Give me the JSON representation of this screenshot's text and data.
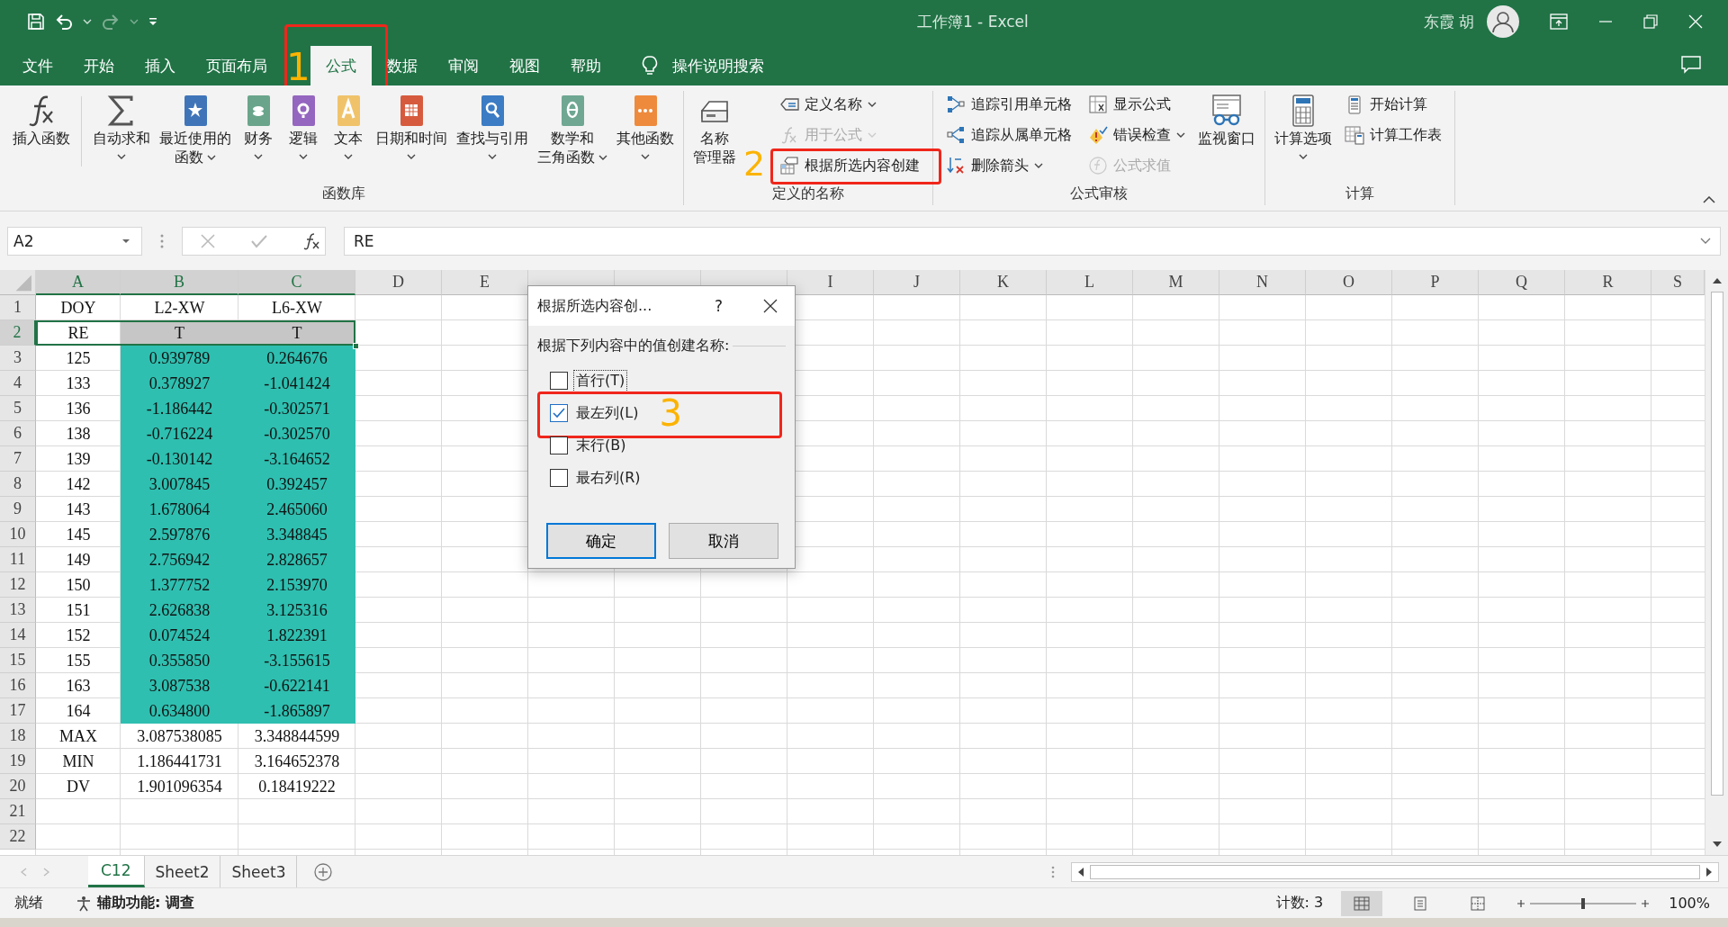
{
  "title_bar": {
    "title": "工作簿1  -  Excel",
    "user": "东霞 胡"
  },
  "menu_tabs": [
    {
      "label": "文件",
      "selected": false
    },
    {
      "label": "开始",
      "selected": false
    },
    {
      "label": "插入",
      "selected": false
    },
    {
      "label": "页面布局",
      "selected": false
    },
    {
      "label": "公式",
      "selected": true,
      "annotation": "1"
    },
    {
      "label": "数据",
      "selected": false
    },
    {
      "label": "审阅",
      "selected": false
    },
    {
      "label": "视图",
      "selected": false
    },
    {
      "label": "帮助",
      "selected": false
    }
  ],
  "tell_me": "操作说明搜索",
  "ribbon_groups": [
    {
      "label": "函数库",
      "items": [
        {
          "kind": "large",
          "label": "插入函数",
          "dropdown": false,
          "divider_after": true
        },
        {
          "kind": "large",
          "label": "自动求和",
          "dropdown": true
        },
        {
          "kind": "large",
          "label_lines": [
            "最近使用的",
            "函数"
          ],
          "dropdown": true,
          "color": "#3f75b8"
        },
        {
          "kind": "large",
          "label": "财务",
          "dropdown": true,
          "color": "#6aa58b"
        },
        {
          "kind": "large",
          "label": "逻辑",
          "dropdown": true,
          "color": "#9466bf"
        },
        {
          "kind": "large",
          "label": "文本",
          "dropdown": true,
          "color": "#f0c36b"
        },
        {
          "kind": "large",
          "label": "日期和时间",
          "dropdown": true,
          "color": "#d65b3e"
        },
        {
          "kind": "large",
          "label": "查找与引用",
          "dropdown": true,
          "color": "#3b7cc4"
        },
        {
          "kind": "large",
          "label_lines": [
            "数学和",
            "三角函数"
          ],
          "dropdown": true,
          "color": "#6fa792"
        },
        {
          "kind": "large",
          "label": "其他函数",
          "dropdown": true,
          "color": "#ee8a3c"
        }
      ]
    },
    {
      "label": "定义的名称",
      "items": [
        {
          "kind": "large",
          "label_lines": [
            "名称",
            "管理器"
          ],
          "dropdown": false
        },
        {
          "kind": "small",
          "label": "定义名称",
          "dropdown": true,
          "disabled": false
        },
        {
          "kind": "small",
          "label": "用于公式",
          "dropdown": true,
          "disabled": true
        },
        {
          "kind": "small",
          "label": "根据所选内容创建",
          "dropdown": false,
          "disabled": false,
          "annotation": "2"
        }
      ]
    },
    {
      "label": "公式审核",
      "items": [
        {
          "kind": "small",
          "label": "追踪引用单元格",
          "dropdown": false,
          "disabled": false
        },
        {
          "kind": "small",
          "label": "追踪从属单元格",
          "dropdown": false,
          "disabled": false
        },
        {
          "kind": "small",
          "label": "删除箭头",
          "dropdown": true,
          "disabled": false
        },
        {
          "kind": "small",
          "label": "显示公式",
          "dropdown": false,
          "disabled": false
        },
        {
          "kind": "small",
          "label": "错误检查",
          "dropdown": true,
          "disabled": false
        },
        {
          "kind": "small",
          "label": "公式求值",
          "dropdown": false,
          "disabled": true
        },
        {
          "kind": "large",
          "label": "监视窗口",
          "dropdown": false
        }
      ]
    },
    {
      "label": "计算",
      "items": [
        {
          "kind": "large",
          "label": "计算选项",
          "dropdown": true
        },
        {
          "kind": "small",
          "label": "开始计算",
          "dropdown": false,
          "disabled": false
        },
        {
          "kind": "small",
          "label": "计算工作表",
          "dropdown": false,
          "disabled": false
        }
      ]
    }
  ],
  "formula_bar": {
    "name_box": "A2",
    "value": "RE"
  },
  "columns": [
    {
      "label": "A",
      "selected": true
    },
    {
      "label": "B",
      "selected": true
    },
    {
      "label": "C",
      "selected": true
    },
    {
      "label": "D",
      "selected": false
    },
    {
      "label": "E",
      "selected": false
    },
    {
      "selected": false
    },
    {
      "selected": false
    },
    {
      "selected": false
    },
    {
      "label": "I",
      "selected": false
    },
    {
      "label": "J",
      "selected": false
    },
    {
      "label": "K",
      "selected": false
    },
    {
      "label": "L",
      "selected": false
    },
    {
      "label": "M",
      "selected": false
    },
    {
      "label": "N",
      "selected": false
    },
    {
      "label": "O",
      "selected": false
    },
    {
      "label": "P",
      "selected": false
    },
    {
      "label": "Q",
      "selected": false
    },
    {
      "label": "R",
      "selected": false
    },
    {
      "label": "S",
      "selected": false
    }
  ],
  "rows": [
    {
      "number": "1",
      "selected": false,
      "shaded": false,
      "cells": [
        "DOY",
        "L2-XW",
        "L6-XW"
      ]
    },
    {
      "number": "2",
      "selected": true,
      "shaded": false,
      "cells": [
        "RE",
        "T",
        "T"
      ]
    },
    {
      "number": "3",
      "selected": false,
      "shaded": true,
      "cells": [
        "125",
        "0.939789",
        "0.264676"
      ]
    },
    {
      "number": "4",
      "selected": false,
      "shaded": true,
      "cells": [
        "133",
        "0.378927",
        "-1.041424"
      ]
    },
    {
      "number": "5",
      "selected": false,
      "shaded": true,
      "cells": [
        "136",
        "-1.186442",
        "-0.302571"
      ]
    },
    {
      "number": "6",
      "selected": false,
      "shaded": true,
      "cells": [
        "138",
        "-0.716224",
        "-0.302570"
      ]
    },
    {
      "number": "7",
      "selected": false,
      "shaded": true,
      "cells": [
        "139",
        "-0.130142",
        "-3.164652"
      ]
    },
    {
      "number": "8",
      "selected": false,
      "shaded": true,
      "cells": [
        "142",
        "3.007845",
        "0.392457"
      ]
    },
    {
      "number": "9",
      "selected": false,
      "shaded": true,
      "cells": [
        "143",
        "1.678064",
        "2.465060"
      ]
    },
    {
      "number": "10",
      "selected": false,
      "shaded": true,
      "cells": [
        "145",
        "2.597876",
        "3.348845"
      ]
    },
    {
      "number": "11",
      "selected": false,
      "shaded": true,
      "cells": [
        "149",
        "2.756942",
        "2.828657"
      ]
    },
    {
      "number": "12",
      "selected": false,
      "shaded": true,
      "cells": [
        "150",
        "1.377752",
        "2.153970"
      ]
    },
    {
      "number": "13",
      "selected": false,
      "shaded": true,
      "cells": [
        "151",
        "2.626838",
        "3.125316"
      ]
    },
    {
      "number": "14",
      "selected": false,
      "shaded": true,
      "cells": [
        "152",
        "0.074524",
        "1.822391"
      ]
    },
    {
      "number": "15",
      "selected": false,
      "shaded": true,
      "cells": [
        "155",
        "0.355850",
        "-3.155615"
      ]
    },
    {
      "number": "16",
      "selected": false,
      "shaded": true,
      "cells": [
        "163",
        "3.087538",
        "-0.622141"
      ]
    },
    {
      "number": "17",
      "selected": false,
      "shaded": true,
      "cells": [
        "164",
        "0.634800",
        "-1.865897"
      ]
    },
    {
      "number": "18",
      "selected": false,
      "shaded": false,
      "cells": [
        "MAX",
        "3.087538085",
        "3.348844599"
      ]
    },
    {
      "number": "19",
      "selected": false,
      "shaded": false,
      "cells": [
        "MIN",
        "1.186441731",
        "3.164652378"
      ]
    },
    {
      "number": "20",
      "selected": false,
      "shaded": false,
      "cells": [
        "DV",
        "1.901096354",
        "0.18419222"
      ]
    },
    {
      "number": "21",
      "selected": false,
      "shaded": false
    },
    {
      "number": "22",
      "selected": false,
      "shaded": false
    }
  ],
  "dialog": {
    "title": "根据所选内容创...",
    "help": "?",
    "prompt": "根据下列内容中的值创建名称:",
    "options": [
      {
        "label": "首行(T)",
        "checked": false,
        "focused": true
      },
      {
        "label": "最左列(L)",
        "checked": true,
        "focused": false,
        "annotation": "3"
      },
      {
        "label": "末行(B)",
        "checked": false,
        "focused": false
      },
      {
        "label": "最右列(R)",
        "checked": false,
        "focused": false
      }
    ],
    "buttons": [
      {
        "label": "确定",
        "default": true
      },
      {
        "label": "取消",
        "default": false
      }
    ]
  },
  "sheet_tabs": [
    {
      "label": "C12",
      "selected": true
    },
    {
      "label": "Sheet2",
      "selected": false
    },
    {
      "label": "Sheet3",
      "selected": false
    }
  ],
  "status_bar": {
    "state": "就绪",
    "accessibility": "辅助功能: 调查",
    "count": "计数: 3",
    "zoom": "100%"
  }
}
